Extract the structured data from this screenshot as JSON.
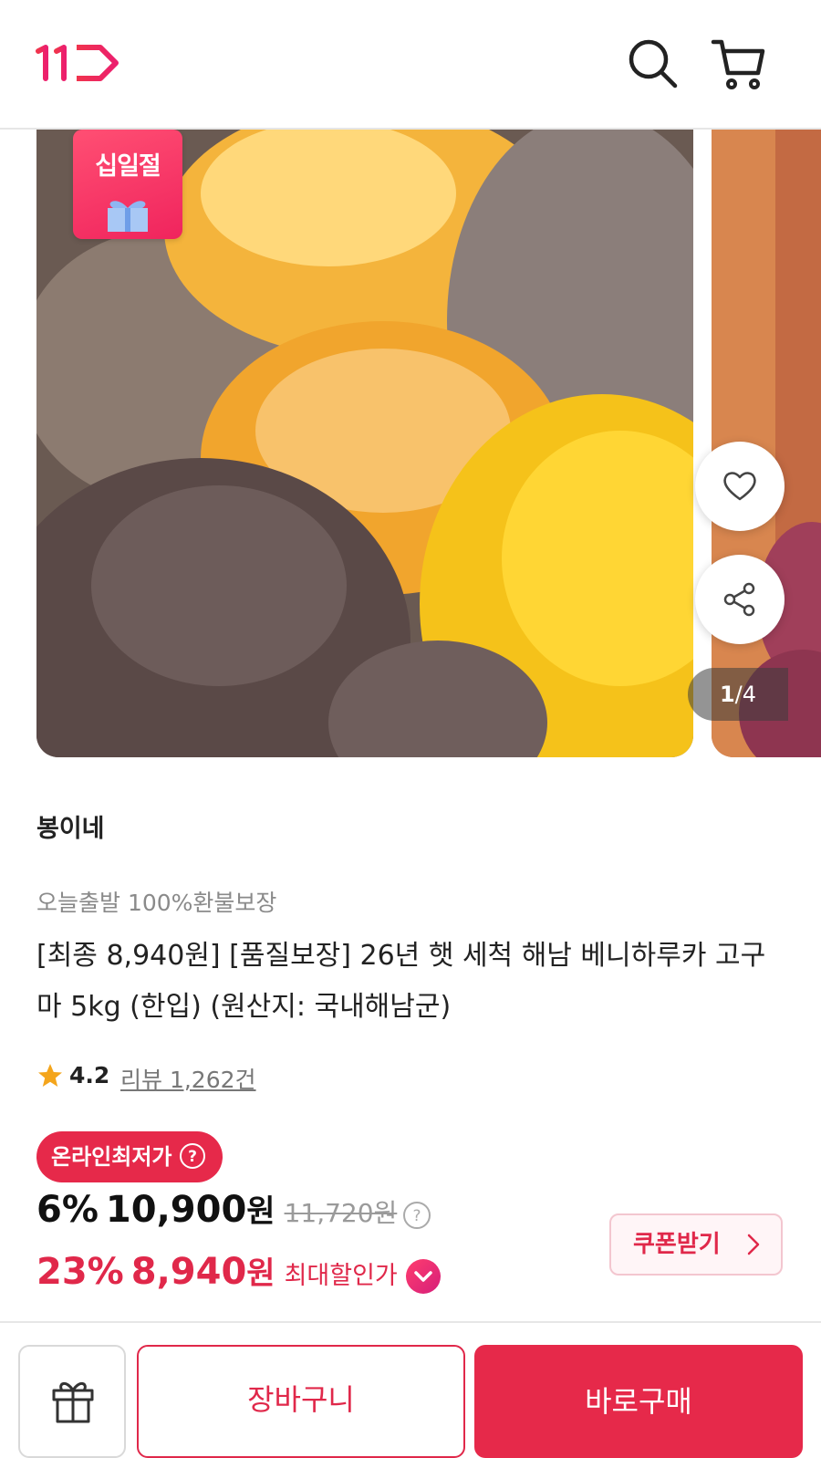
{
  "header": {
    "logo_icon": "11st-logo",
    "search_icon": "search-icon",
    "cart_icon": "cart-icon"
  },
  "gallery": {
    "event_badge_text": "십일절",
    "current_page": "1",
    "page_separator": "/",
    "total_pages": "4",
    "wish_icon": "heart-icon",
    "share_icon": "share-icon"
  },
  "product": {
    "seller": "봉이네",
    "subtitle": "오늘출발 100%환불보장",
    "title": "[최종 8,940원] [품질보장] 26년 햇 세척 해남 베니하루카 고구마 5kg (한입) (원산지: 국내해남군)",
    "rating": "4.2",
    "review_label": "리뷰 1,262건"
  },
  "pricing": {
    "lowest_badge": "온라인최저가",
    "rate": "6%",
    "price": "10,900",
    "price_unit": "원",
    "original_price": "11,720원",
    "max_rate": "23%",
    "max_price": "8,940",
    "max_price_unit": "원",
    "max_label": "최대할인가",
    "coupon_label": "쿠폰받기"
  },
  "bottom": {
    "gift_icon": "gift-icon",
    "cart_button": "장바구니",
    "buy_button": "바로구매"
  },
  "colors": {
    "accent": "#e6294a",
    "brand_logo": "#e8384f"
  }
}
